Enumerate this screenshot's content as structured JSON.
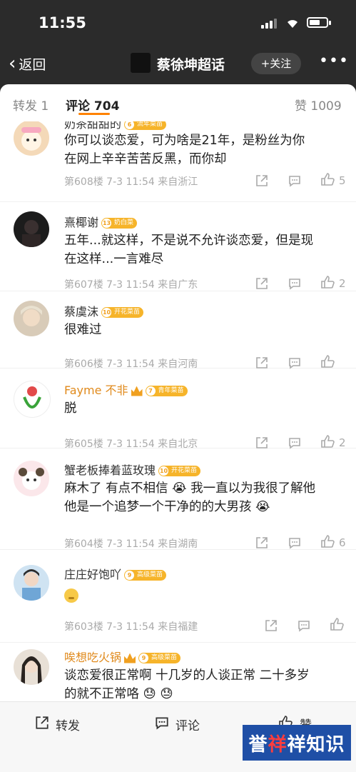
{
  "status_bar": {
    "time": "11:55"
  },
  "nav": {
    "back_label": "返回",
    "topic_title": "蔡徐坤超话",
    "follow_label": "+关注",
    "more_label": "•••"
  },
  "tabs": {
    "repost": "转发 1",
    "comments": "评论 704",
    "likes": "赞 1009"
  },
  "comments": [
    {
      "name": "奶茶甜甜的",
      "badge": "流年菜苗",
      "badge_level": "6",
      "text": [
        "你可以谈恋爱，可为啥是21年，是粉丝为你",
        "在网上辛辛苦苦反黑，而你却"
      ],
      "meta": "第608楼  7-3 11:54  来自浙江",
      "likes": "5"
    },
    {
      "name": "熹椰谢",
      "badge": "奶白菜",
      "badge_level": "13",
      "text": [
        "五年...就这样，不是说不允许谈恋爱，但是现",
        "在这样...一言难尽"
      ],
      "meta": "第607楼  7-3 11:54  来自广东",
      "likes": "2"
    },
    {
      "name": "蔡虞沫",
      "badge": "开花菜苗",
      "badge_level": "10",
      "text": [
        "很难过"
      ],
      "meta": "第606楼  7-3 11:54  来自河南",
      "likes": ""
    },
    {
      "name": "Fayme 不非",
      "badge": "青年菜苗",
      "badge_level": "7",
      "text": [
        "脱"
      ],
      "meta": "第605楼  7-3 11:54  来自北京",
      "likes": "2"
    },
    {
      "name": "蟹老板捧着蓝玫瑰",
      "badge": "开花菜苗",
      "badge_level": "10",
      "text": [
        "麻木了 有点不相信 😭 我一直以为我很了解他",
        "他是一个追梦一个干净的的大男孩 😭"
      ],
      "meta": "第604楼  7-3 11:54  来自湖南",
      "likes": "6"
    },
    {
      "name": "庄庄好饱吖",
      "badge": "高级菜苗",
      "badge_level": "9",
      "text": [
        ""
      ],
      "meta": "第603楼  7-3 11:54  来自福建",
      "likes": ""
    },
    {
      "name": "唉想吃火锅",
      "badge": "高级菜苗",
      "badge_level": "9",
      "text": [
        "谈恋爱很正常啊 十几岁的人谈正常 二十多岁",
        "的就不正常咯 😓 😓"
      ],
      "meta": "",
      "likes": ""
    }
  ],
  "bottom": {
    "repost": "转发",
    "comment": "评论",
    "like": "赞"
  },
  "watermark": {
    "left": "誉",
    "mid": "祥",
    "right": "祥知识"
  }
}
